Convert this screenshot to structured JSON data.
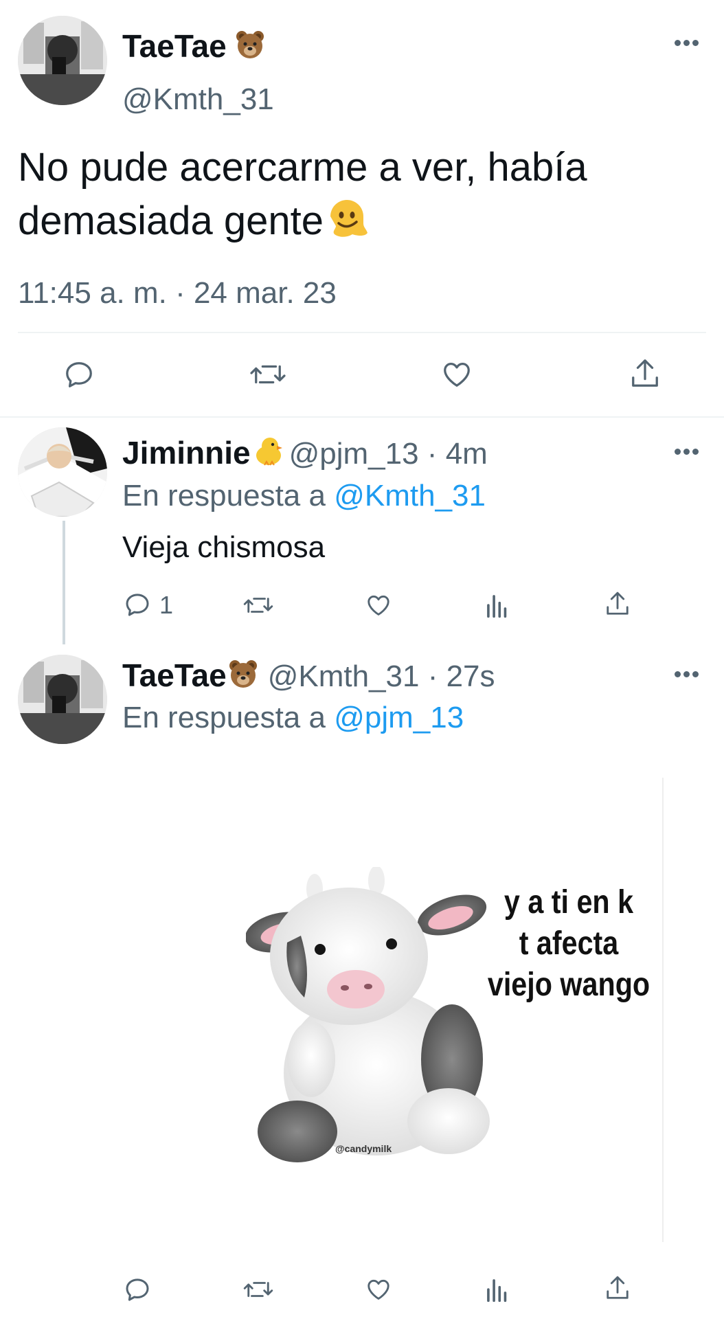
{
  "main_tweet": {
    "name": "TaeTae",
    "name_emoji": "bear-emoji",
    "handle": "@Kmth_31",
    "text_line1": "No pude acercarme a ver, había",
    "text_line2": "demasiada gente",
    "text_emoji": "melting-face-emoji",
    "timestamp": "11:45 a. m. · 24 mar. 23",
    "actions": [
      "reply-icon",
      "retweet-icon",
      "like-icon",
      "share-icon"
    ]
  },
  "reply1": {
    "name": "Jiminnie",
    "name_emoji": "chick-emoji",
    "handle_time": "@pjm_13 · 4m",
    "replying_prefix": "En respuesta a",
    "replying_to": "@Kmth_31",
    "text": "Vieja chismosa",
    "reply_count": "1"
  },
  "reply2": {
    "name": "TaeTae",
    "name_emoji": "bear-emoji",
    "handle_time": "@Kmth_31 · 27s",
    "replying_prefix": "En respuesta a",
    "replying_to": "@pjm_13",
    "meme": {
      "line1": "y a ti en k",
      "line2": "t afecta",
      "line3": "viejo wango",
      "watermark": "@candymilk"
    }
  },
  "colors": {
    "text": "#0f1419",
    "secondary": "#536471",
    "accent": "#1d9bf0",
    "divider": "#eff3f4"
  }
}
